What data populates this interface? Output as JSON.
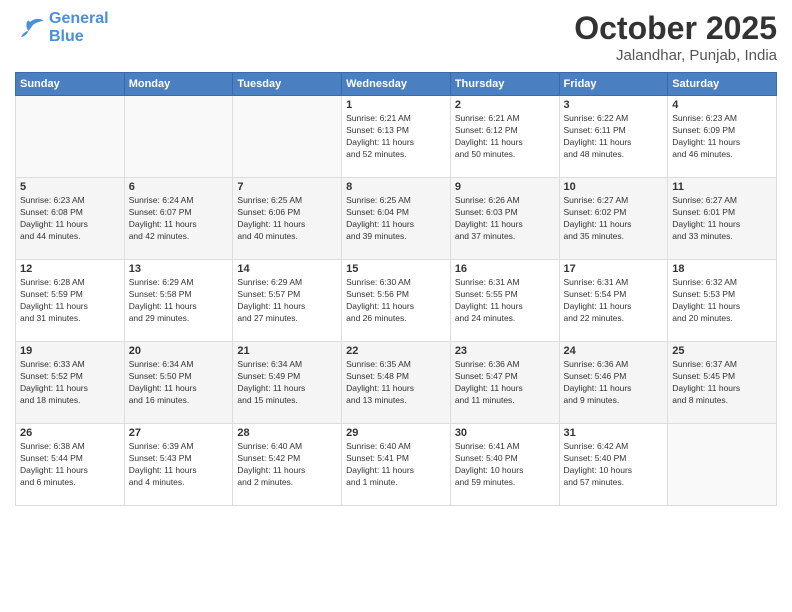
{
  "logo": {
    "line1": "General",
    "line2": "Blue"
  },
  "title": "October 2025",
  "subtitle": "Jalandhar, Punjab, India",
  "days_header": [
    "Sunday",
    "Monday",
    "Tuesday",
    "Wednesday",
    "Thursday",
    "Friday",
    "Saturday"
  ],
  "weeks": [
    [
      {
        "day": "",
        "info": ""
      },
      {
        "day": "",
        "info": ""
      },
      {
        "day": "",
        "info": ""
      },
      {
        "day": "1",
        "info": "Sunrise: 6:21 AM\nSunset: 6:13 PM\nDaylight: 11 hours\nand 52 minutes."
      },
      {
        "day": "2",
        "info": "Sunrise: 6:21 AM\nSunset: 6:12 PM\nDaylight: 11 hours\nand 50 minutes."
      },
      {
        "day": "3",
        "info": "Sunrise: 6:22 AM\nSunset: 6:11 PM\nDaylight: 11 hours\nand 48 minutes."
      },
      {
        "day": "4",
        "info": "Sunrise: 6:23 AM\nSunset: 6:09 PM\nDaylight: 11 hours\nand 46 minutes."
      }
    ],
    [
      {
        "day": "5",
        "info": "Sunrise: 6:23 AM\nSunset: 6:08 PM\nDaylight: 11 hours\nand 44 minutes."
      },
      {
        "day": "6",
        "info": "Sunrise: 6:24 AM\nSunset: 6:07 PM\nDaylight: 11 hours\nand 42 minutes."
      },
      {
        "day": "7",
        "info": "Sunrise: 6:25 AM\nSunset: 6:06 PM\nDaylight: 11 hours\nand 40 minutes."
      },
      {
        "day": "8",
        "info": "Sunrise: 6:25 AM\nSunset: 6:04 PM\nDaylight: 11 hours\nand 39 minutes."
      },
      {
        "day": "9",
        "info": "Sunrise: 6:26 AM\nSunset: 6:03 PM\nDaylight: 11 hours\nand 37 minutes."
      },
      {
        "day": "10",
        "info": "Sunrise: 6:27 AM\nSunset: 6:02 PM\nDaylight: 11 hours\nand 35 minutes."
      },
      {
        "day": "11",
        "info": "Sunrise: 6:27 AM\nSunset: 6:01 PM\nDaylight: 11 hours\nand 33 minutes."
      }
    ],
    [
      {
        "day": "12",
        "info": "Sunrise: 6:28 AM\nSunset: 5:59 PM\nDaylight: 11 hours\nand 31 minutes."
      },
      {
        "day": "13",
        "info": "Sunrise: 6:29 AM\nSunset: 5:58 PM\nDaylight: 11 hours\nand 29 minutes."
      },
      {
        "day": "14",
        "info": "Sunrise: 6:29 AM\nSunset: 5:57 PM\nDaylight: 11 hours\nand 27 minutes."
      },
      {
        "day": "15",
        "info": "Sunrise: 6:30 AM\nSunset: 5:56 PM\nDaylight: 11 hours\nand 26 minutes."
      },
      {
        "day": "16",
        "info": "Sunrise: 6:31 AM\nSunset: 5:55 PM\nDaylight: 11 hours\nand 24 minutes."
      },
      {
        "day": "17",
        "info": "Sunrise: 6:31 AM\nSunset: 5:54 PM\nDaylight: 11 hours\nand 22 minutes."
      },
      {
        "day": "18",
        "info": "Sunrise: 6:32 AM\nSunset: 5:53 PM\nDaylight: 11 hours\nand 20 minutes."
      }
    ],
    [
      {
        "day": "19",
        "info": "Sunrise: 6:33 AM\nSunset: 5:52 PM\nDaylight: 11 hours\nand 18 minutes."
      },
      {
        "day": "20",
        "info": "Sunrise: 6:34 AM\nSunset: 5:50 PM\nDaylight: 11 hours\nand 16 minutes."
      },
      {
        "day": "21",
        "info": "Sunrise: 6:34 AM\nSunset: 5:49 PM\nDaylight: 11 hours\nand 15 minutes."
      },
      {
        "day": "22",
        "info": "Sunrise: 6:35 AM\nSunset: 5:48 PM\nDaylight: 11 hours\nand 13 minutes."
      },
      {
        "day": "23",
        "info": "Sunrise: 6:36 AM\nSunset: 5:47 PM\nDaylight: 11 hours\nand 11 minutes."
      },
      {
        "day": "24",
        "info": "Sunrise: 6:36 AM\nSunset: 5:46 PM\nDaylight: 11 hours\nand 9 minutes."
      },
      {
        "day": "25",
        "info": "Sunrise: 6:37 AM\nSunset: 5:45 PM\nDaylight: 11 hours\nand 8 minutes."
      }
    ],
    [
      {
        "day": "26",
        "info": "Sunrise: 6:38 AM\nSunset: 5:44 PM\nDaylight: 11 hours\nand 6 minutes."
      },
      {
        "day": "27",
        "info": "Sunrise: 6:39 AM\nSunset: 5:43 PM\nDaylight: 11 hours\nand 4 minutes."
      },
      {
        "day": "28",
        "info": "Sunrise: 6:40 AM\nSunset: 5:42 PM\nDaylight: 11 hours\nand 2 minutes."
      },
      {
        "day": "29",
        "info": "Sunrise: 6:40 AM\nSunset: 5:41 PM\nDaylight: 11 hours\nand 1 minute."
      },
      {
        "day": "30",
        "info": "Sunrise: 6:41 AM\nSunset: 5:40 PM\nDaylight: 10 hours\nand 59 minutes."
      },
      {
        "day": "31",
        "info": "Sunrise: 6:42 AM\nSunset: 5:40 PM\nDaylight: 10 hours\nand 57 minutes."
      },
      {
        "day": "",
        "info": ""
      }
    ]
  ]
}
